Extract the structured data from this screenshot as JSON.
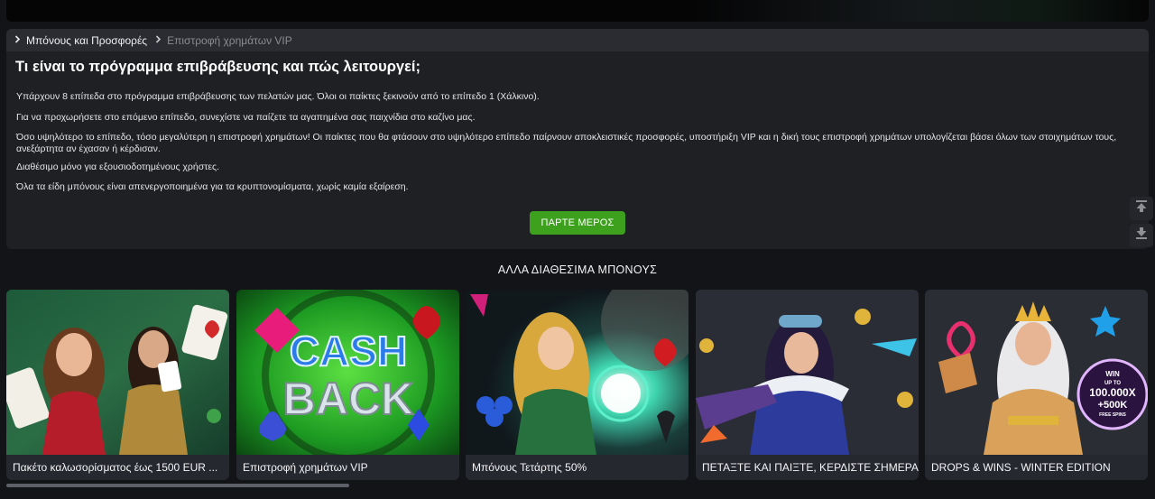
{
  "breadcrumb": {
    "parent": "Μπόνους και Προσφορές",
    "current": "Επιστροφή χρημάτων VIP"
  },
  "article": {
    "title": "Τι είναι το πρόγραμμα επιβράβευσης και πώς λειτουργεί;",
    "paragraphs": [
      "Υπάρχουν 8 επίπεδα στο πρόγραμμα επιβράβευσης των πελατών μας. Όλοι οι παίκτες ξεκινούν από το επίπεδο 1 (Χάλκινο).",
      "Για να προχωρήσετε στο επόμενο επίπεδο, συνεχίστε να παίζετε τα αγαπημένα σας παιχνίδια στο καζίνο μας.",
      "Όσο υψηλότερο το επίπεδο, τόσο μεγαλύτερη η επιστροφή χρημάτων! Οι παίκτες που θα φτάσουν στο υψηλότερο επίπεδο παίρνουν αποκλειστικές προσφορές, υποστήριξη VIP και η δική τους επιστροφή χρημάτων υπολογίζεται βάσει όλων των στοιχημάτων τους, ανεξάρτητα αν έχασαν ή κέρδισαν.",
      "Διαθέσιμο μόνο για εξουσιοδοτημένους χρήστες.",
      "Όλα τα είδη μπόνους είναι απενεργοποιημένα για τα κρυπτονομίσματα, χωρίς καμία εξαίρεση."
    ],
    "cta_label": "ΠΑΡΤΕ ΜΕΡΟΣ"
  },
  "other_bonuses": {
    "title": "ΑΛΛΑ ΔΙΑΘΕΣΙΜΑ ΜΠΟΝΟΥΣ",
    "cards": [
      {
        "label": "Πακέτο καλωσορίσματος έως 1500 EUR ..."
      },
      {
        "label": "Επιστροφή χρημάτων VIP",
        "image_text": [
          "CASH",
          "BACK"
        ]
      },
      {
        "label": "Μπόνους Τετάρτης 50%"
      },
      {
        "label": "ΠΕΤΑΞΤΕ ΚΑΙ ΠΑΙΞΤΕ, ΚΕΡΔΙΣΤΕ ΣΗΜΕΡΑ!"
      },
      {
        "label": "DROPS & WINS - WINTER EDITION",
        "badge": [
          "WIN",
          "UP TO",
          "100.000X",
          "+500K",
          "FREE SPINS"
        ]
      }
    ]
  },
  "icons": {
    "breadcrumb_separator": "chevron-right-icon",
    "scroll_up": "arrow-up-bar-icon",
    "scroll_down": "arrow-down-bar-icon"
  },
  "colors": {
    "accent_green": "#3ea11d",
    "panel_bg": "#1f2024",
    "page_bg": "#131417"
  }
}
